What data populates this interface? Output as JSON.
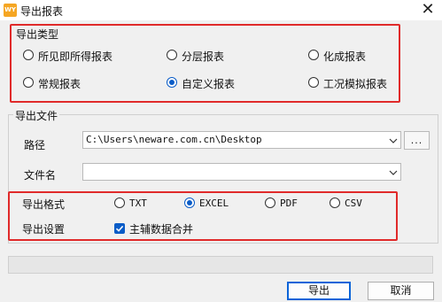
{
  "window": {
    "title": "导出报表",
    "app_icon_text": "WY",
    "close_symbol": "✕"
  },
  "export_type": {
    "title": "导出类型",
    "options": [
      {
        "label": "所见即所得报表",
        "selected": false
      },
      {
        "label": "分层报表",
        "selected": false
      },
      {
        "label": "化成报表",
        "selected": false
      },
      {
        "label": "常规报表",
        "selected": false
      },
      {
        "label": "自定义报表",
        "selected": true
      },
      {
        "label": "工况模拟报表",
        "selected": false
      }
    ]
  },
  "export_file": {
    "title": "导出文件",
    "path_label": "路径",
    "path_value": "C:\\Users\\neware.com.cn\\Desktop",
    "browse_label": "...",
    "filename_label": "文件名",
    "filename_value": ""
  },
  "format": {
    "label": "导出格式",
    "options": [
      {
        "label": "TXT",
        "selected": false
      },
      {
        "label": "EXCEL",
        "selected": true
      },
      {
        "label": "PDF",
        "selected": false
      },
      {
        "label": "CSV",
        "selected": false
      }
    ]
  },
  "settings": {
    "label": "导出设置",
    "merge_label": "主辅数据合并",
    "merge_checked": true
  },
  "progress": {
    "value": 0
  },
  "buttons": {
    "export": "导出",
    "cancel": "取消"
  },
  "colors": {
    "accent": "#0a5cc7",
    "highlight": "#e02a2a",
    "app_icon": "#f5a623"
  }
}
